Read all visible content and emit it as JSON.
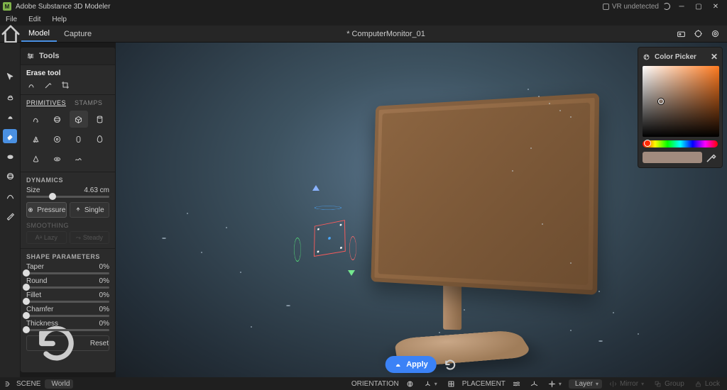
{
  "app": {
    "name": "Adobe Substance 3D Modeler",
    "logo_char": "M"
  },
  "vr_status": "VR undetected",
  "menu": [
    "File",
    "Edit",
    "Help"
  ],
  "top": {
    "modes": [
      {
        "label": "Model",
        "active": true
      },
      {
        "label": "Capture",
        "active": false
      }
    ],
    "document": "*  ComputerMonitor_01"
  },
  "vtools": [
    {
      "name": "select-tool",
      "active": false
    },
    {
      "name": "clay-tool",
      "active": false
    },
    {
      "name": "buildup-tool",
      "active": false
    },
    {
      "name": "erase-tool",
      "active": true
    },
    {
      "name": "smooth-tool",
      "active": false
    },
    {
      "name": "warp-tool",
      "active": false
    },
    {
      "name": "crease-tool",
      "active": false
    },
    {
      "name": "paint-tool",
      "active": false
    }
  ],
  "tools_panel": {
    "title": "Tools",
    "tool_name": "Erase tool",
    "tabs": [
      {
        "label": "PRIMITIVES",
        "active": true
      },
      {
        "label": "STAMPS",
        "active": false
      }
    ],
    "primitives": [
      "curve",
      "sphere",
      "box",
      "cylinder",
      "prism",
      "disc",
      "capsule",
      "egg",
      "cone",
      "torus",
      "squiggle"
    ],
    "active_primitive_idx": 2,
    "dynamics_label": "DYNAMICS",
    "size_label": "Size",
    "size_value": "4.63 cm",
    "size_pct": 32,
    "pressure_label": "Pressure",
    "single_label": "Single",
    "smoothing_label": "SMOOTHING",
    "lazy_label": "Lazy",
    "steady_label": "Steady",
    "shape_params_label": "SHAPE PARAMETERS",
    "params": [
      {
        "label": "Taper",
        "value": "0%",
        "pct": 0
      },
      {
        "label": "Round",
        "value": "0%",
        "pct": 0
      },
      {
        "label": "Fillet",
        "value": "0%",
        "pct": 0
      },
      {
        "label": "Chamfer",
        "value": "0%",
        "pct": 0
      },
      {
        "label": "Thickness",
        "value": "0%",
        "pct": 0
      }
    ],
    "reset_label": "Reset"
  },
  "color_picker": {
    "title": "Color Picker",
    "current_hex": "#a18b7e"
  },
  "apply": {
    "label": "Apply"
  },
  "statusbar": {
    "scene_label": "SCENE",
    "world_label": "World",
    "orientation_label": "ORIENTATION",
    "placement_label": "PLACEMENT",
    "layer_label": "Layer",
    "mirror_label": "Mirror",
    "group_label": "Group",
    "lock_label": "Lock"
  }
}
